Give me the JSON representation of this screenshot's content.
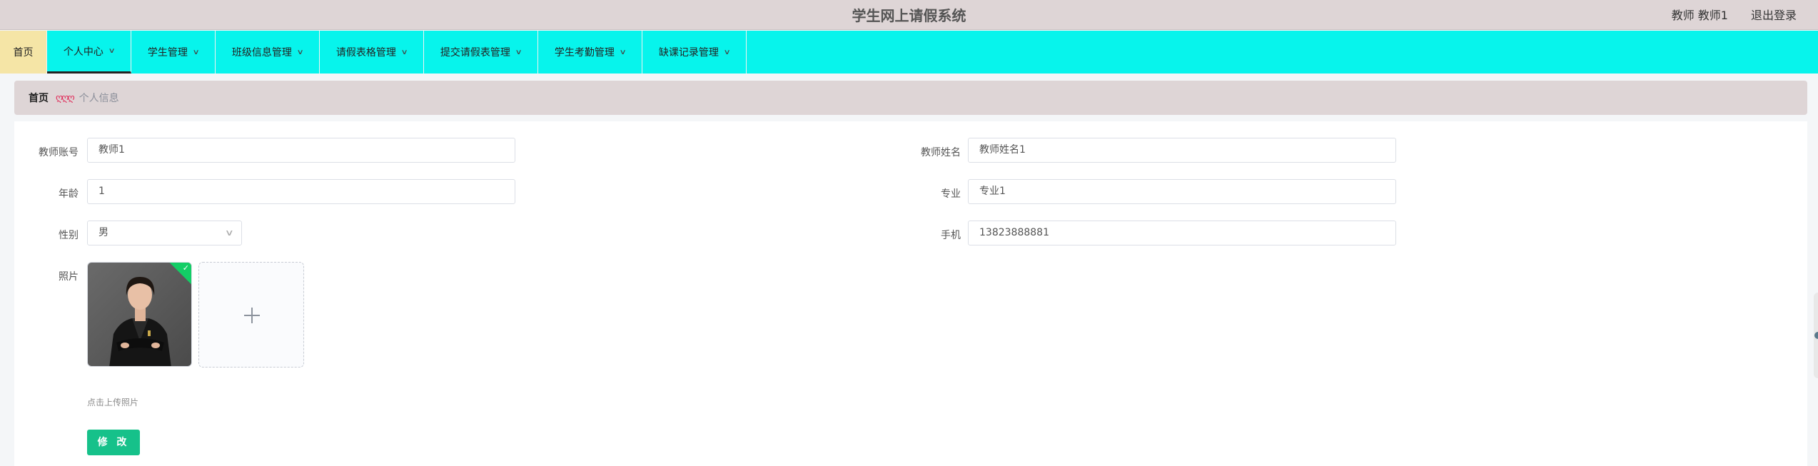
{
  "header": {
    "app_title": "学生网上请假系统",
    "user_info": "教师 教师1",
    "logout_label": "退出登录"
  },
  "nav": {
    "home_label": "首页",
    "items": [
      {
        "label": "个人中心",
        "active": true
      },
      {
        "label": "学生管理"
      },
      {
        "label": "班级信息管理"
      },
      {
        "label": "请假表格管理"
      },
      {
        "label": "提交请假表管理"
      },
      {
        "label": "学生考勤管理"
      },
      {
        "label": "缺课记录管理"
      }
    ],
    "colors": {
      "bar": "#07f4ec",
      "home": "#f5e5a6"
    }
  },
  "breadcrumb": {
    "home": "首页",
    "separator": "ღღღ",
    "current": "个人信息"
  },
  "form": {
    "account_label": "教师账号",
    "account_value": "教师1",
    "name_label": "教师姓名",
    "name_value": "教师姓名1",
    "age_label": "年龄",
    "age_value": "1",
    "major_label": "专业",
    "major_value": "专业1",
    "gender_label": "性别",
    "gender_value": "男",
    "phone_label": "手机",
    "phone_value": "13823888881",
    "photo_label": "照片",
    "upload_tip": "点击上传照片",
    "submit_label": "修 改",
    "accent_color": "#16c18a"
  }
}
